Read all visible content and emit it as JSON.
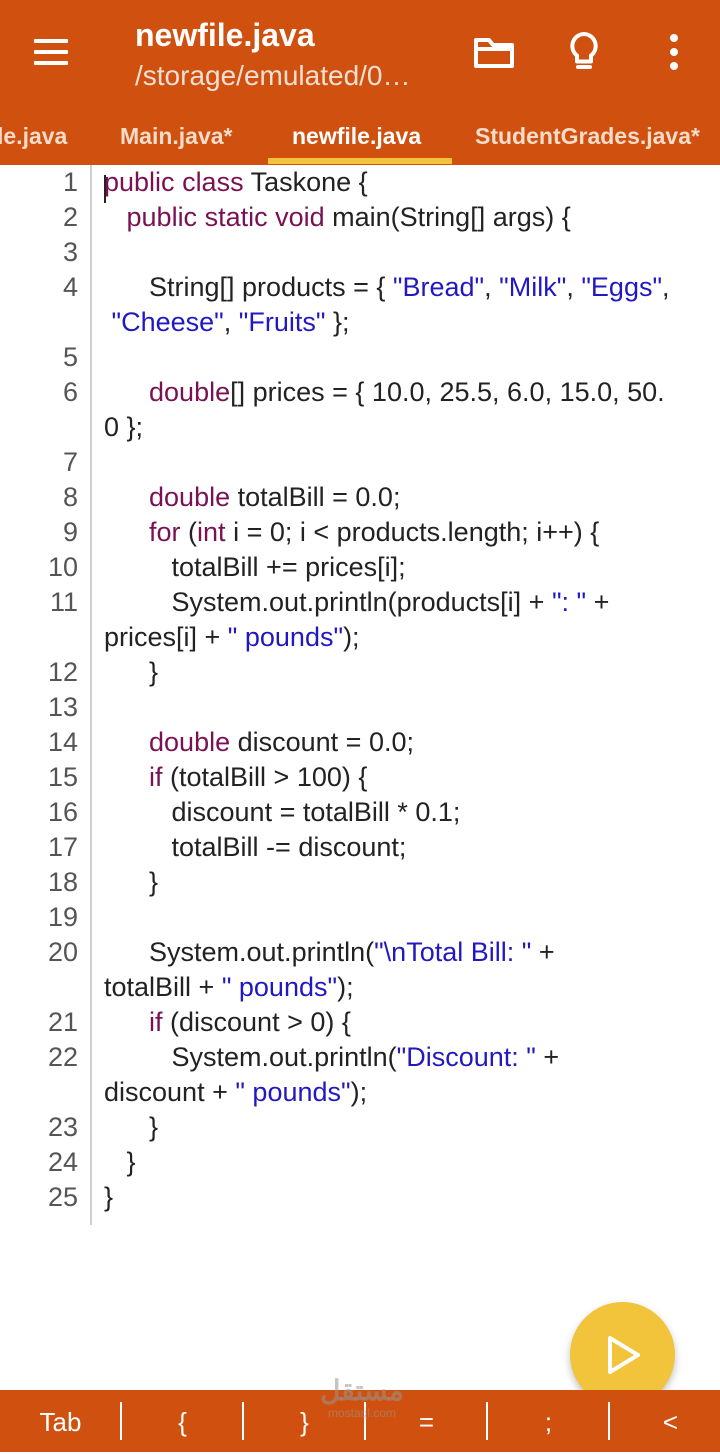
{
  "appbar": {
    "title": "newfile.java",
    "subtitle": "/storage/emulated/0…",
    "icons": [
      "menu-icon",
      "folder-icon",
      "lightbulb-icon",
      "more-vert-icon"
    ]
  },
  "tabs": [
    {
      "label": "le.java",
      "active": false
    },
    {
      "label": "Main.java*",
      "active": false
    },
    {
      "label": "newfile.java",
      "active": true
    },
    {
      "label": "StudentGrades.java*",
      "active": false
    }
  ],
  "editor": {
    "line_numbers": [
      "1",
      "2",
      "3",
      "4",
      "5",
      "6",
      "7",
      "8",
      "9",
      "10",
      "11",
      "12",
      "13",
      "14",
      "15",
      "16",
      "17",
      "18",
      "19",
      "20",
      "21",
      "22",
      "23",
      "24",
      "25"
    ],
    "lines": [
      "public class Taskone {",
      "   public static void main(String[] args) {",
      "",
      "      String[] products = { \"Bread\", \"Milk\", \"Eggs\",",
      " \"Cheese\", \"Fruits\" };",
      "",
      "      double[] prices = { 10.0, 25.5, 6.0, 15.0, 50.",
      "0 };",
      "",
      "      double totalBill = 0.0;",
      "      for (int i = 0; i < products.length; i++) {",
      "         totalBill += prices[i];",
      "         System.out.println(products[i] + \": \" +",
      "prices[i] + \" pounds\");",
      "      }",
      "",
      "      double discount = 0.0;",
      "      if (totalBill > 100) {",
      "         discount = totalBill * 0.1;",
      "         totalBill -= discount;",
      "      }",
      "",
      "      System.out.println(\"\\nTotal Bill: \" +",
      "totalBill + \" pounds\");",
      "      if (discount > 0) {",
      "         System.out.println(\"Discount: \" +",
      "discount + \" pounds\");",
      "      }",
      "   }",
      "}"
    ]
  },
  "fab": {
    "icon": "play-icon"
  },
  "watermark": {
    "arabic": "مستقل",
    "domain": "mostaql.com"
  },
  "keybar": {
    "keys": [
      "Tab",
      "{",
      "}",
      "=",
      ";",
      "<"
    ]
  },
  "colors": {
    "primary": "#d0510f",
    "accent": "#f2c43c",
    "keyword": "#7a1152",
    "string": "#2218c2",
    "text": "#222222"
  }
}
